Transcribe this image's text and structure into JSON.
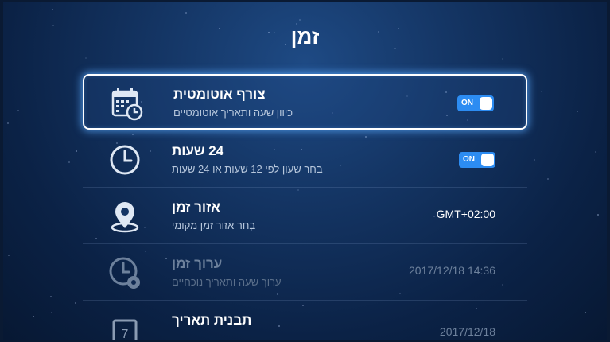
{
  "header": {
    "title": "זמן"
  },
  "settings": [
    {
      "title": "צורף אוטומטית",
      "subtitle": "כיוון שעה ותאריך אוטומטיים",
      "toggle": "ON",
      "icon": "calendar-clock-icon"
    },
    {
      "title": "24 שעות",
      "subtitle": "בחר שעון לפי 12 שעות או 24 שעות",
      "toggle": "ON",
      "icon": "clock-icon"
    },
    {
      "title": "אזור זמן",
      "subtitle": "בחר אזור זמן מקומי",
      "value": "GMT+02:00",
      "icon": "location-pin-icon"
    },
    {
      "title": "ערוך זמן",
      "subtitle": "ערוך שעה ותאריך נוכחיים",
      "value": "2017/12/18 14:36",
      "icon": "clock-gear-icon"
    },
    {
      "title": "תבנית תאריך",
      "value": "2017/12/18",
      "icon": "calendar-date-icon",
      "icon_text": "7"
    }
  ],
  "colors": {
    "accent": "#2c8cf2",
    "focus_glow": "#5aaaff",
    "background": "#143564"
  }
}
